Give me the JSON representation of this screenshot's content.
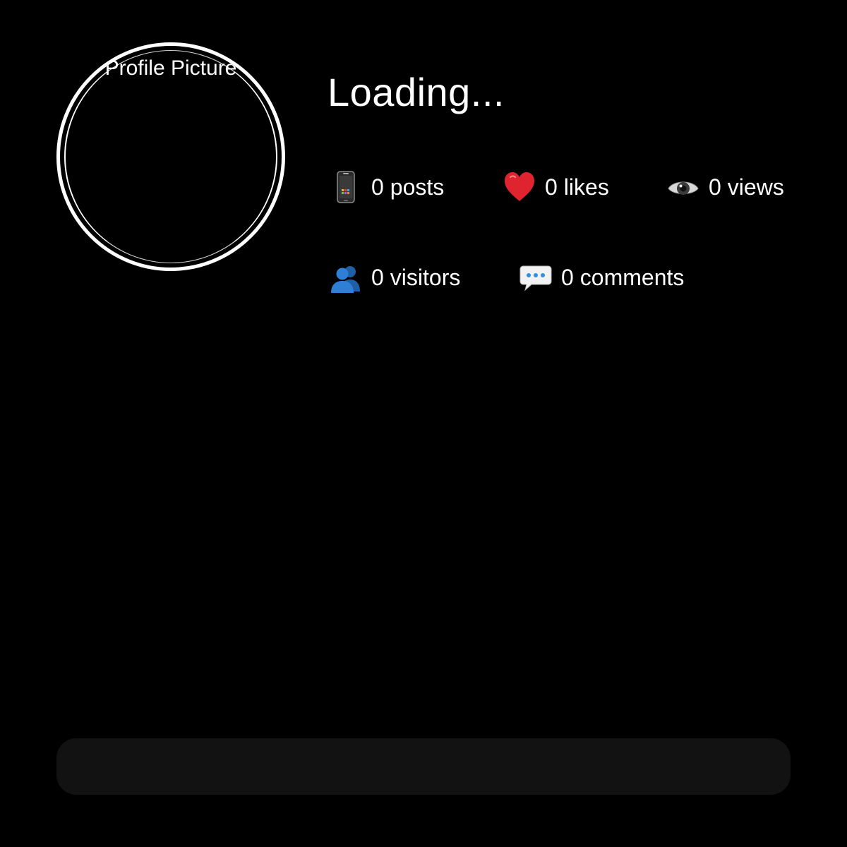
{
  "profile": {
    "picture_alt": "Profile Picture",
    "title": "Loading..."
  },
  "stats": {
    "posts": {
      "icon": "mobile-phone-icon",
      "value": "0",
      "label": "posts"
    },
    "likes": {
      "icon": "red-heart-icon",
      "value": "0",
      "label": "likes"
    },
    "views": {
      "icon": "eye-icon",
      "value": "0",
      "label": "views"
    },
    "visitors": {
      "icon": "people-icon",
      "value": "0",
      "label": "visitors"
    },
    "comments": {
      "icon": "speech-bubble-icon",
      "value": "0",
      "label": "comments"
    }
  },
  "colors": {
    "background": "#000000",
    "text": "#ffffff",
    "bottom_bar": "#121212",
    "heart": "#e0242f",
    "people": "#2f7fd6"
  }
}
